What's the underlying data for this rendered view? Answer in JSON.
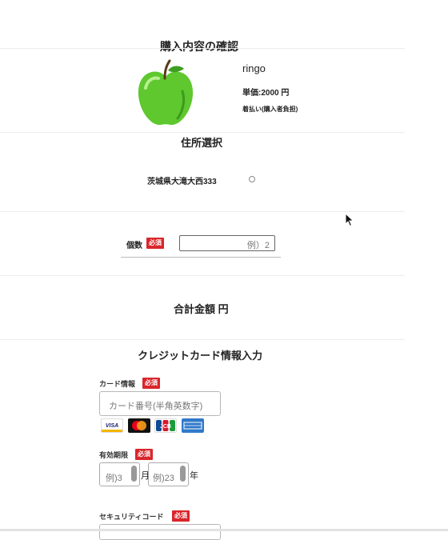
{
  "page": {
    "title": "購入内容の確認"
  },
  "product": {
    "name": "ringo",
    "unit_price": "単価:2000 円",
    "shipping": "着払い(購入者負担)"
  },
  "address": {
    "section_title": "住所選択",
    "option_label": "茨城県大滝大西333"
  },
  "quantity": {
    "label": "個数",
    "required": "必須",
    "placeholder": "例）2"
  },
  "total": {
    "label": "合計金額 円"
  },
  "credit": {
    "section_title": "クレジットカード情報入力",
    "card_info_label": "カード情報",
    "card_required": "必須",
    "card_placeholder": "カード番号(半角英数字)",
    "card_brands": [
      "VISA",
      "MasterCard",
      "JCB",
      "AMEX"
    ],
    "expiry_label": "有効期限",
    "expiry_required": "必須",
    "month_placeholder": "例)3",
    "month_unit": "月",
    "year_placeholder": "例)23",
    "year_unit": "年",
    "security_label": "セキュリティコード",
    "security_required": "必須"
  },
  "colors": {
    "required_badge": "#d9262b",
    "apple_green": "#5ec82e"
  }
}
